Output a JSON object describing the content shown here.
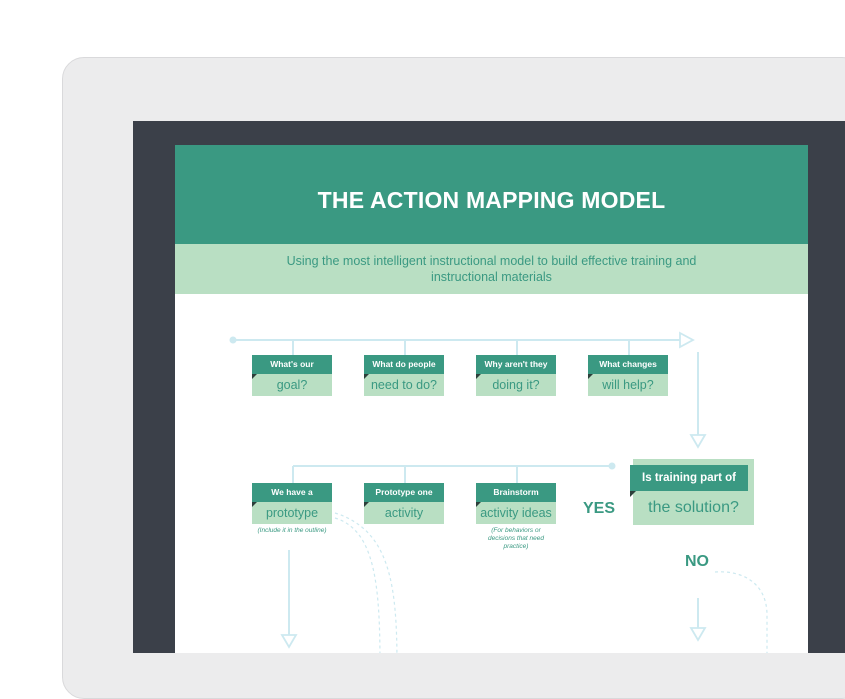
{
  "document": {
    "title": "THE ACTION MAPPING MODEL",
    "subtitle": "Using the most intelligent instructional model to build effective training and instructional materials"
  },
  "top_row": [
    {
      "tag": "What's our",
      "main": "goal?"
    },
    {
      "tag": "What do people",
      "main": "need to do?"
    },
    {
      "tag": "Why aren't they",
      "main": "doing it?"
    },
    {
      "tag": "What changes",
      "main": "will help?"
    }
  ],
  "decision": {
    "tag": "Is training part of",
    "main": "the solution?"
  },
  "yes_label": "YES",
  "no_label": "NO",
  "bottom_row": [
    {
      "tag": "We have a",
      "main": "prototype",
      "note": "(Include it in the outline)"
    },
    {
      "tag": "Prototype one",
      "main": "activity",
      "note": ""
    },
    {
      "tag": "Brainstorm",
      "main": "activity ideas",
      "note": "(For behaviors or decisions that need practice)"
    }
  ],
  "colors": {
    "primary": "#3a9982",
    "light": "#b9dfc3",
    "connector": "#cde9f0",
    "screen_bezel": "#3b4049",
    "device": "#ececed"
  }
}
